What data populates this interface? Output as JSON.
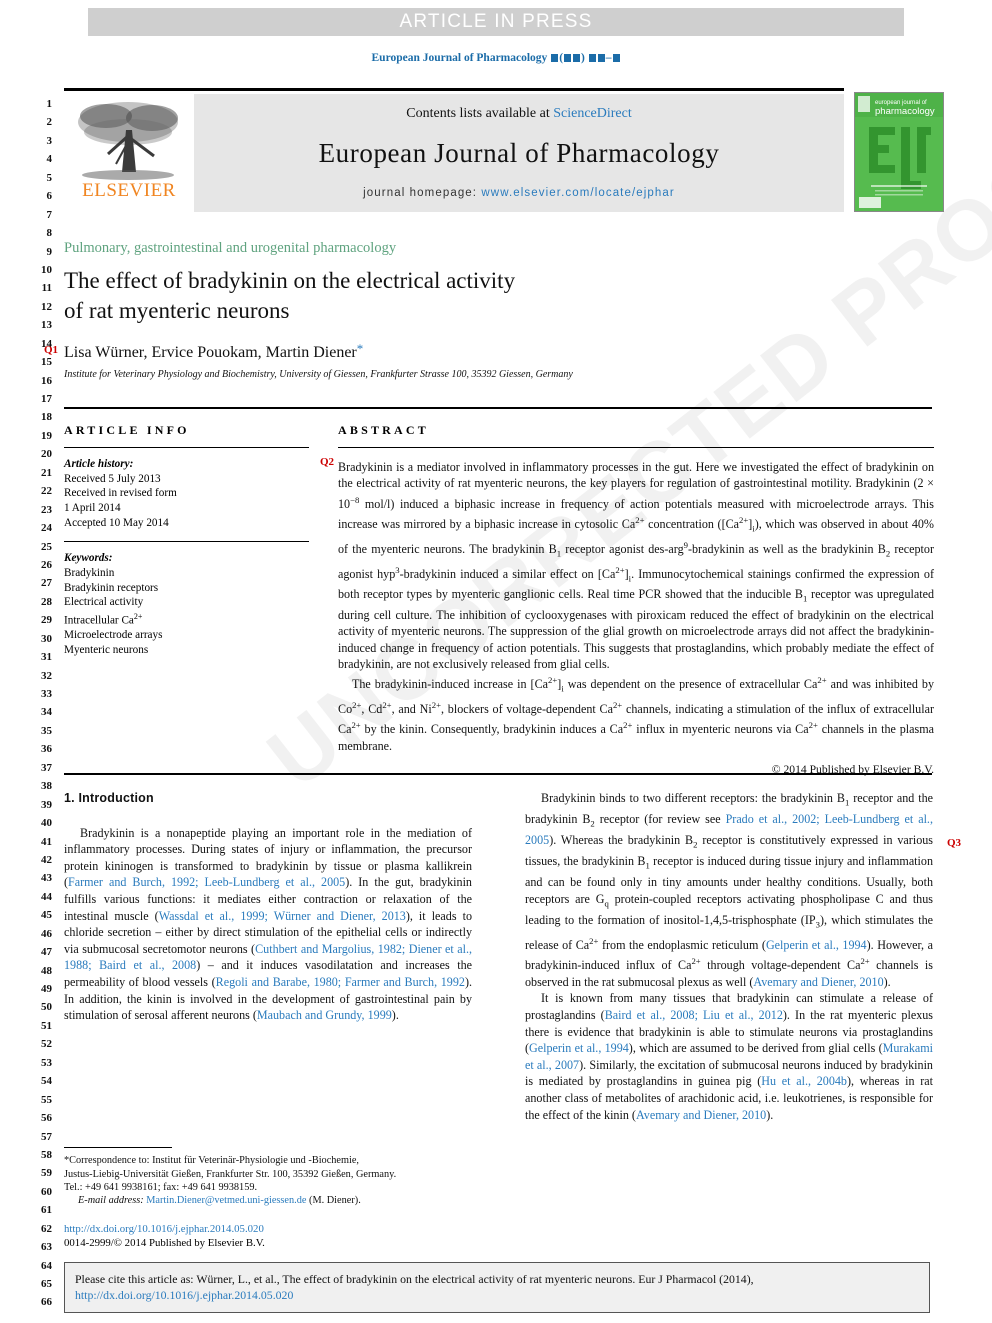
{
  "banner": {
    "text": "ARTICLE IN PRESS"
  },
  "running_head": {
    "journal": "European Journal of Pharmacology"
  },
  "masthead": {
    "contents_prefix": "Contents lists available at ",
    "contents_link": "ScienceDirect",
    "journal_title": "European Journal of Pharmacology",
    "homepage_prefix": "journal homepage: ",
    "homepage_link": "www.elsevier.com/locate/ejphar",
    "publisher": "ELSEVIER",
    "cover_line1": "european journal of",
    "cover_line2": "pharmacology",
    "cover_logo": "ejp"
  },
  "title_block": {
    "section_label": "Pulmonary, gastrointestinal and urogenital pharmacology",
    "title_line1": "The effect of bradykinin on the electrical activity",
    "title_line2": "of rat myenteric neurons",
    "authors": "Lisa Würner, Ervice Pouokam, Martin Diener",
    "affiliation": "Institute for Veterinary Physiology and Biochemistry, University of Giessen, Frankfurter Strasse 100, 35392 Giessen, Germany"
  },
  "query_markers": {
    "q1": "Q1",
    "q2": "Q2",
    "q3": "Q3"
  },
  "article_info": {
    "heading": "ARTICLE INFO",
    "history_label": "Article history:",
    "history": [
      "Received 5 July 2013",
      "Received in revised form",
      "1 April 2014",
      "Accepted 10 May 2014"
    ],
    "keywords_label": "Keywords:",
    "keywords": [
      "Bradykinin",
      "Bradykinin receptors",
      "Electrical activity",
      "Intracellular Ca2+",
      "Microelectrode arrays",
      "Myenteric neurons"
    ]
  },
  "abstract": {
    "heading": "ABSTRACT",
    "paragraph1": "Bradykinin is a mediator involved in inflammatory processes in the gut. Here we investigated the effect of bradykinin on the electrical activity of rat myenteric neurons, the key players for regulation of gastrointestinal motility. Bradykinin (2 × 10−8 mol/l) induced a biphasic increase in frequency of action potentials measured with microelectrode arrays. This increase was mirrored by a biphasic increase in cytosolic Ca2+ concentration ([Ca2+]i), which was observed in about 40% of the myenteric neurons. The bradykinin B1 receptor agonist des-arg9-bradykinin as well as the bradykinin B2 receptor agonist hyp3-bradykinin induced a similar effect on [Ca2+]i. Immunocytochemical stainings confirmed the expression of both receptor types by myenteric ganglionic cells. Real time PCR showed that the inducible B1 receptor was upregulated during cell culture. The inhibition of cyclooxygenases with piroxicam reduced the effect of bradykinin on the electrical activity of myenteric neurons. The suppression of the glial growth on microelectrode arrays did not affect the bradykinin-induced change in frequency of action potentials. This suggests that prostaglandins, which probably mediate the effect of bradykinin, are not exclusively released from glial cells.",
    "paragraph2": "The bradykinin-induced increase in [Ca2+]i was dependent on the presence of extracellular Ca2+ and was inhibited by Co2+, Cd2+, and Ni2+, blockers of voltage-dependent Ca2+ channels, indicating a stimulation of the influx of extracellular Ca2+ by the kinin. Consequently, bradykinin induces a Ca2+ influx in myenteric neurons via Ca2+ channels in the plasma membrane.",
    "copyright": "© 2014 Published by Elsevier B.V."
  },
  "introduction": {
    "heading": "1. Introduction",
    "left_paragraph": "Bradykinin is a nonapeptide playing an important role in the mediation of inflammatory processes. During states of injury or inflammation, the precursor protein kininogen is transformed to bradykinin by tissue or plasma kallikrein (Farmer and Burch, 1992; Leeb-Lundberg et al., 2005). In the gut, bradykinin fulfills various functions: it mediates either contraction or relaxation of the intestinal muscle (Wassdal et al., 1999; Würner and Diener, 2013), it leads to chloride secretion – either by direct stimulation of the epithelial cells or indirectly via submucosal secretomotor neurons (Cuthbert and Margolius, 1982; Diener et al., 1988; Baird et al., 2008) – and it induces vasodilatation and increases the permeability of blood vessels (Regoli and Barabe, 1980; Farmer and Burch, 1992). In addition, the kinin is involved in the development of gastrointestinal pain by stimulation of serosal afferent neurons (Maubach and Grundy, 1999).",
    "right_paragraph1": "Bradykinin binds to two different receptors: the bradykinin B1 receptor and the bradykinin B2 receptor (for review see Prado et al., 2002; Leeb-Lundberg et al., 2005). Whereas the bradykinin B2 receptor is constitutively expressed in various tissues, the bradykinin B1 receptor is induced during tissue injury and inflammation and can be found only in tiny amounts under healthy conditions. Usually, both receptors are Gq protein-coupled receptors activating phospholipase C and thus leading to the formation of inositol-1,4,5-trisphosphate (IP3), which stimulates the release of Ca2+ from the endoplasmic reticulum (Gelperin et al., 1994). However, a bradykinin-induced influx of Ca2+ through voltage-dependent Ca2+ channels is observed in the rat submucosal plexus as well (Avemary and Diener, 2010).",
    "right_paragraph2": "It is known from many tissues that bradykinin can stimulate a release of prostaglandins (Baird et al., 2008; Liu et al., 2012). In the rat myenteric plexus there is evidence that bradykinin is able to stimulate neurons via prostaglandins (Gelperin et al., 1994), which are assumed to be derived from glial cells (Murakami et al., 2007). Similarly, the excitation of submucosal neurons induced by bradykinin is mediated by prostaglandins in guinea pig (Hu et al., 2004b), whereas in rat another class of metabolites of arachidonic acid, i.e. leukotrienes, is responsible for the effect of the kinin (Avemary and Diener, 2010)."
  },
  "footnote": {
    "line1": "*Correspondence to: Institut für Veterinär-Physiologie und -Biochemie,",
    "line2": "Justus-Liebig-Universität Gießen, Frankfurter Str. 100, 35392 Gießen, Germany.",
    "line3": "Tel.: +49 641 9938161; fax: +49 641 9938159.",
    "email_label": "E-mail address:",
    "email": "Martin.Diener@vetmed.uni-giessen.de",
    "email_suffix": "(M. Diener)."
  },
  "doi_block": {
    "doi": "http://dx.doi.org/10.1016/j.ejphar.2014.05.020",
    "issn_line": "0014-2999/© 2014 Published by Elsevier B.V."
  },
  "cite_box": {
    "text_before": "Please cite this article as: Würner, L., et al., The effect of bradykinin on the electrical activity of rat myenteric neurons. Eur J Pharmacol (2014), ",
    "link": "http://dx.doi.org/10.1016/j.ejphar.2014.05.020"
  },
  "watermark": {
    "text": "UNCORRECTED PROOF"
  },
  "line_numbers": {
    "first": 1,
    "last": 66
  },
  "colors": {
    "link": "#2a7bbd",
    "section_label": "#5fa37f",
    "query_marker": "#cc0000",
    "elsevier_orange": "#f08521",
    "banner_bg": "#cfcfcf",
    "masthead_bg": "#e6e6e6",
    "cover_green": "#51b849"
  }
}
